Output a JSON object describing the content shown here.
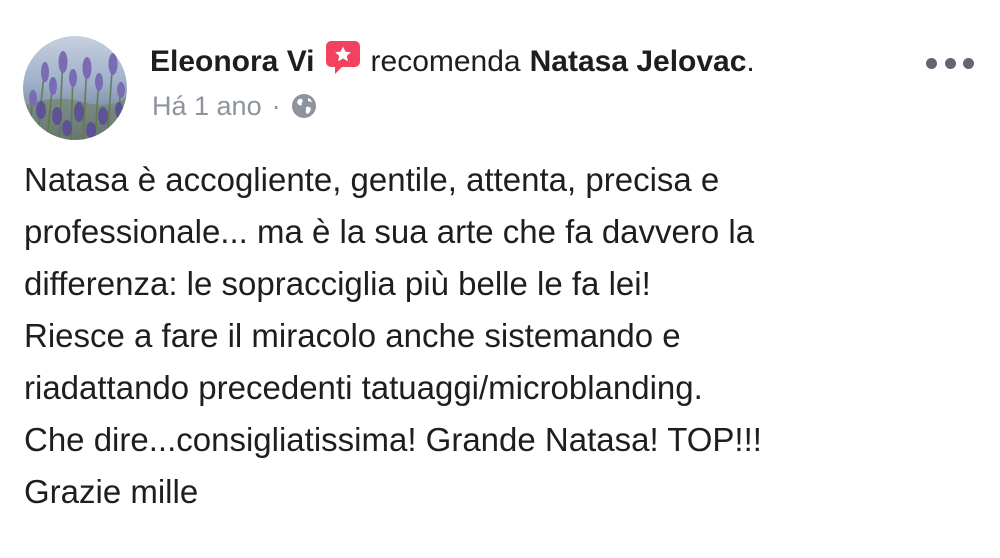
{
  "post": {
    "author": "Eleonora Vi",
    "recommend_verb": "recomenda",
    "page_name": "Natasa Jelovac",
    "page_name_suffix": ".",
    "timestamp": "Há 1 ano",
    "separator": "·",
    "privacy_icon": "globe-icon",
    "recommend_icon": "recommendation-badge-icon",
    "more_icon": "more-options-icon",
    "accent_color": "#f3425f",
    "meta_color": "#8d949e",
    "body_lines": [
      "Natasa è accogliente, gentile, attenta, precisa e",
      "professionale... ma è la sua arte che fa davvero la",
      "differenza: le sopracciglia più belle le fa lei!",
      "Riesce a fare il miracolo anche sistemando e",
      "riadattando precedenti tatuaggi/microblanding.",
      "Che dire...consigliatissima! Grande Natasa! TOP!!!",
      "Grazie mille"
    ]
  }
}
